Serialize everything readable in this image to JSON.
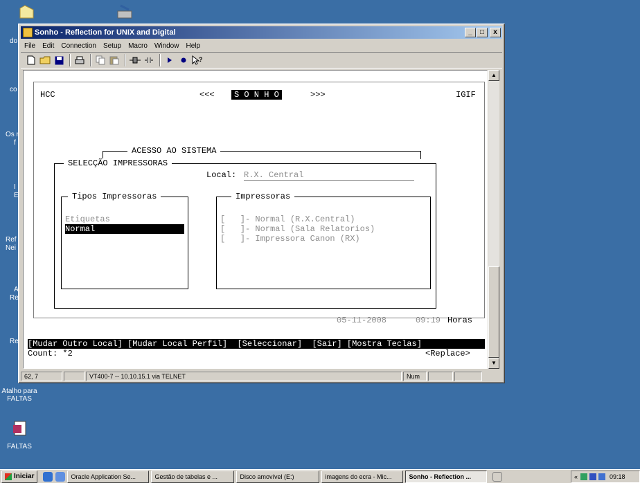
{
  "desktop": {
    "icons": [
      {
        "label": "Atalho para FALTAS",
        "line1": "Atalho para",
        "line2": "FALTAS"
      },
      {
        "label": "FALTAS"
      }
    ],
    "partial_labels": [
      "do",
      "co",
      "Os r",
      "f",
      "I",
      "E",
      "Ref",
      "Nei",
      "A",
      "Re",
      "Re"
    ]
  },
  "window": {
    "title": "Sonho - Reflection for UNIX and Digital",
    "controls": {
      "minimize": "_",
      "maximize": "□",
      "close": "x"
    },
    "menu": [
      "File",
      "Edit",
      "Connection",
      "Setup",
      "Macro",
      "Window",
      "Help"
    ],
    "toolbar_icons": [
      "new-icon",
      "open-icon",
      "save-icon",
      "print-icon",
      "copy-icon",
      "paste-icon",
      "connect-icon",
      "disconnect-icon",
      "play-icon",
      "record-icon",
      "help-icon"
    ]
  },
  "terminal": {
    "header_left": "HCC",
    "header_center_left": "<<<",
    "header_center": "S O N H O",
    "header_center_right": ">>>",
    "header_right": "IGIF",
    "acesso_title": "ACESSO AO SISTEMA",
    "seleccao_title": "SELECÇÃO IMPRESSORAS",
    "local_label": "Local:",
    "local_value": "R.X. Central",
    "tipos_title": "Tipos Impressoras",
    "tipos": [
      "Etiquetas",
      "Normal"
    ],
    "selected_tipo_index": 1,
    "impressoras_title": "Impressoras",
    "impressoras": [
      "[   ]- Normal (R.X.Central)",
      "[   ]- Normal (Sala Relatorios)",
      "[   ]- Impressora Canon (RX)"
    ],
    "date": "05-11-2008",
    "time": "09:19",
    "time_label": "Horas",
    "function_keys": "[Mudar Outro Local] [Mudar Local Perfil]  [Seleccionar]  [Sair] [Mostra Teclas]",
    "count_line": "Count: *2",
    "mode": "<Replace>"
  },
  "statusbar": {
    "cursor": "62, 7",
    "connection": "VT400-7 -- 10.10.15.1 via TELNET",
    "num": "Num"
  },
  "taskbar": {
    "start": "Iniciar",
    "tasks": [
      {
        "label": "Oracle Application Se...",
        "active": false
      },
      {
        "label": "Gestão de tabelas e ...",
        "active": false
      },
      {
        "label": "Disco amovível (E:)",
        "active": false
      },
      {
        "label": "imagens do ecra - Mic...",
        "active": false
      },
      {
        "label": "Sonho - Reflection ...",
        "active": true
      }
    ],
    "tray_left": "«",
    "clock": "09:18"
  }
}
